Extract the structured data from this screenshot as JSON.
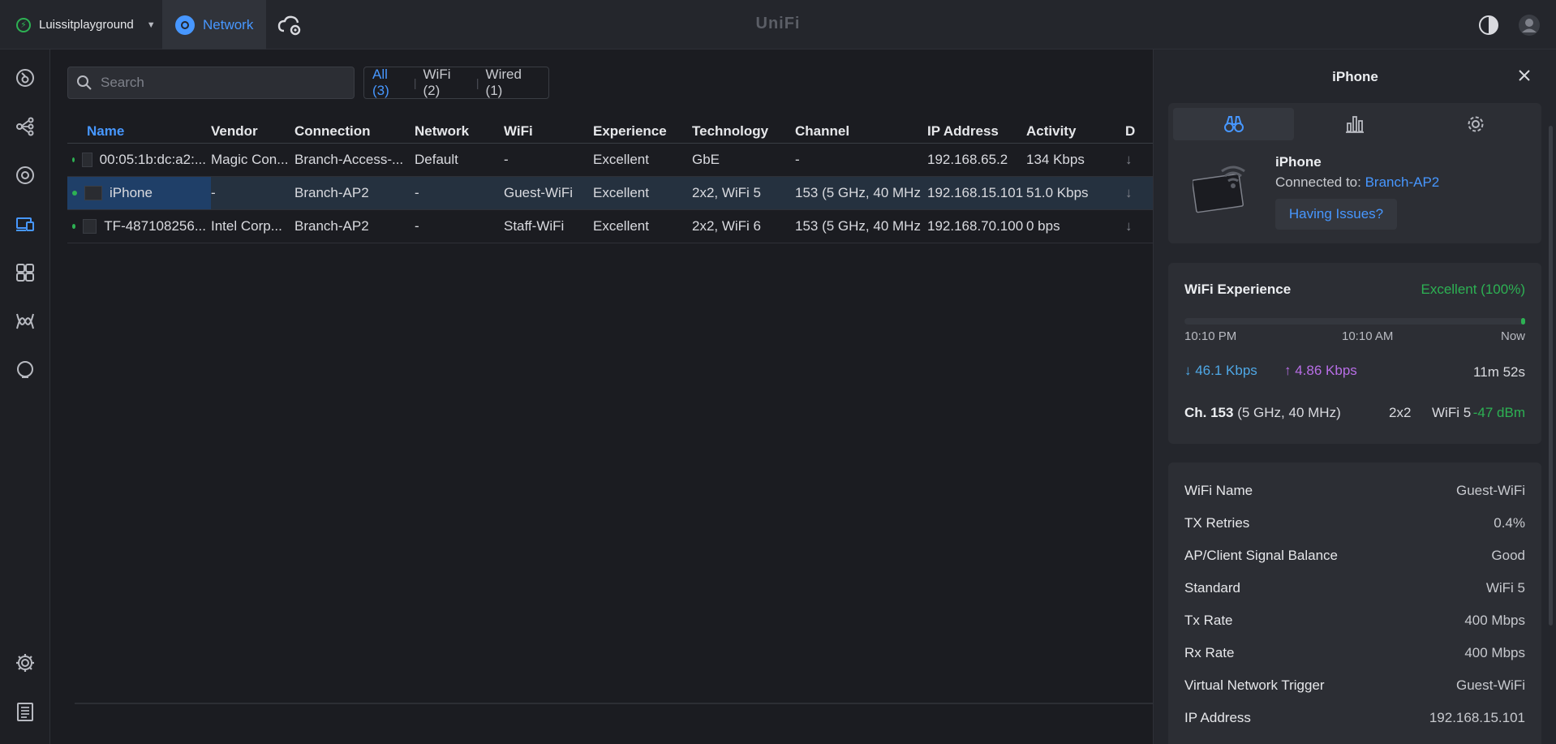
{
  "topbar": {
    "site_name": "Luissitplayground",
    "app_name": "Network",
    "brand": "UniFi"
  },
  "sidebar": {
    "icons": [
      "dashboard-icon",
      "topology-icon",
      "devices-icon",
      "clients-icon",
      "ports-icon",
      "insights-icon",
      "alerts-icon",
      "settings-icon",
      "logs-icon"
    ]
  },
  "search": {
    "placeholder": "Search"
  },
  "filters": {
    "all": "All (3)",
    "wifi": "WiFi (2)",
    "wired": "Wired (1)"
  },
  "table": {
    "columns": [
      "Name",
      "Vendor",
      "Connection",
      "Network",
      "WiFi",
      "Experience",
      "Technology",
      "Channel",
      "IP Address",
      "Activity",
      "D"
    ],
    "rows": [
      {
        "name": "00:05:1b:dc:a2:...",
        "vendor": "Magic Con...",
        "connection": "Branch-Access-...",
        "network": "Default",
        "wifi": "-",
        "experience": "Excellent",
        "technology": "GbE",
        "channel": "-",
        "ip": "192.168.65.2",
        "activity": "134 Kbps",
        "d": "↓"
      },
      {
        "name": "iPhone",
        "vendor": "-",
        "connection": "Branch-AP2",
        "network": "-",
        "wifi": "Guest-WiFi",
        "experience": "Excellent",
        "technology": "2x2, WiFi 5",
        "channel": "153 (5 GHz, 40 MHz",
        "ip": "192.168.15.101",
        "activity": "51.0 Kbps",
        "d": "↓"
      },
      {
        "name": "TF-487108256...",
        "vendor": "Intel Corp...",
        "connection": "Branch-AP2",
        "network": "-",
        "wifi": "Staff-WiFi",
        "experience": "Excellent",
        "technology": "2x2, WiFi 6",
        "channel": "153 (5 GHz, 40 MHz",
        "ip": "192.168.70.100",
        "activity": "0 bps",
        "d": "↓"
      }
    ]
  },
  "panel": {
    "title": "iPhone",
    "device_name": "iPhone",
    "connected_label": "Connected to: ",
    "connected_to": "Branch-AP2",
    "issues_button": "Having Issues?",
    "wifi_experience": {
      "title": "WiFi Experience",
      "value": "Excellent (100%)",
      "level_percent": 100,
      "time_start": "10:10 PM",
      "time_mid": "10:10 AM",
      "time_end": "Now",
      "download": "↓  46.1 Kbps",
      "upload": "↑  4.86 Kbps",
      "uptime": "11m 52s",
      "channel_label": "Ch. 153",
      "channel_detail": " (5 GHz, 40 MHz)",
      "mimo": "2x2",
      "standard": "WiFi 5",
      "signal": "-47 dBm"
    },
    "properties": [
      {
        "key": "WiFi Name",
        "value": "Guest-WiFi"
      },
      {
        "key": "TX Retries",
        "value": "0.4%"
      },
      {
        "key": "AP/Client Signal Balance",
        "value": "Good"
      },
      {
        "key": "Standard",
        "value": "WiFi 5"
      },
      {
        "key": "Tx Rate",
        "value": "400 Mbps"
      },
      {
        "key": "Rx Rate",
        "value": "400 Mbps"
      },
      {
        "key": "Virtual Network Trigger",
        "value": "Guest-WiFi"
      },
      {
        "key": "IP Address",
        "value": "192.168.15.101"
      }
    ]
  },
  "colors": {
    "accent": "#4797ff",
    "success": "#2db153",
    "download": "#4fa8e6",
    "upload": "#b86ee6",
    "background": "#1b1c21"
  }
}
